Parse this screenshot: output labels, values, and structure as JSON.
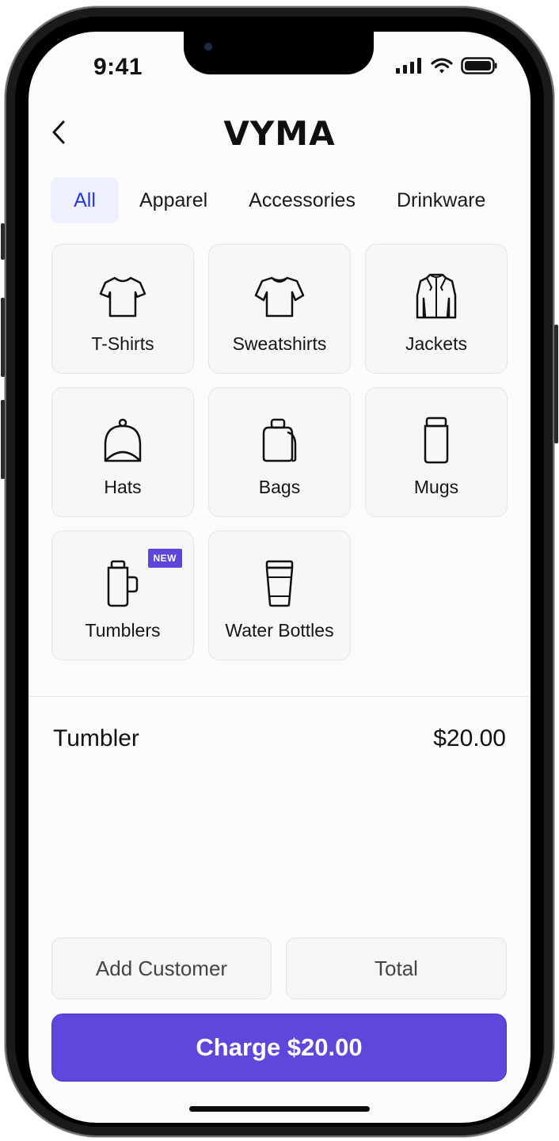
{
  "status_bar": {
    "time": "9:41"
  },
  "header": {
    "brand": "VYMA"
  },
  "tabs": [
    {
      "label": "All",
      "active": true
    },
    {
      "label": "Apparel",
      "active": false
    },
    {
      "label": "Accessories",
      "active": false
    },
    {
      "label": "Drinkware",
      "active": false
    }
  ],
  "categories": [
    {
      "label": "T-Shirts",
      "icon": "tshirt-icon"
    },
    {
      "label": "Sweatshirts",
      "icon": "sweatshirt-icon"
    },
    {
      "label": "Jackets",
      "icon": "jacket-icon"
    },
    {
      "label": "Hats",
      "icon": "hat-icon"
    },
    {
      "label": "Bags",
      "icon": "bag-icon"
    },
    {
      "label": "Mugs",
      "icon": "mug-icon"
    },
    {
      "label": "Tumblers",
      "icon": "tumbler-icon",
      "badge": "NEW"
    },
    {
      "label": "Water Bottles",
      "icon": "water-bottle-icon"
    }
  ],
  "cart": {
    "item_name": "Tumbler",
    "item_price": "$20.00"
  },
  "actions": {
    "add_customer": "Add Customer",
    "total": "Total",
    "charge": "Charge $20.00"
  },
  "colors": {
    "accent": "#5f47dc",
    "active_tab_text": "#2b35e0",
    "active_tab_bg": "#eef0fd",
    "badge": "#5f44d9"
  }
}
